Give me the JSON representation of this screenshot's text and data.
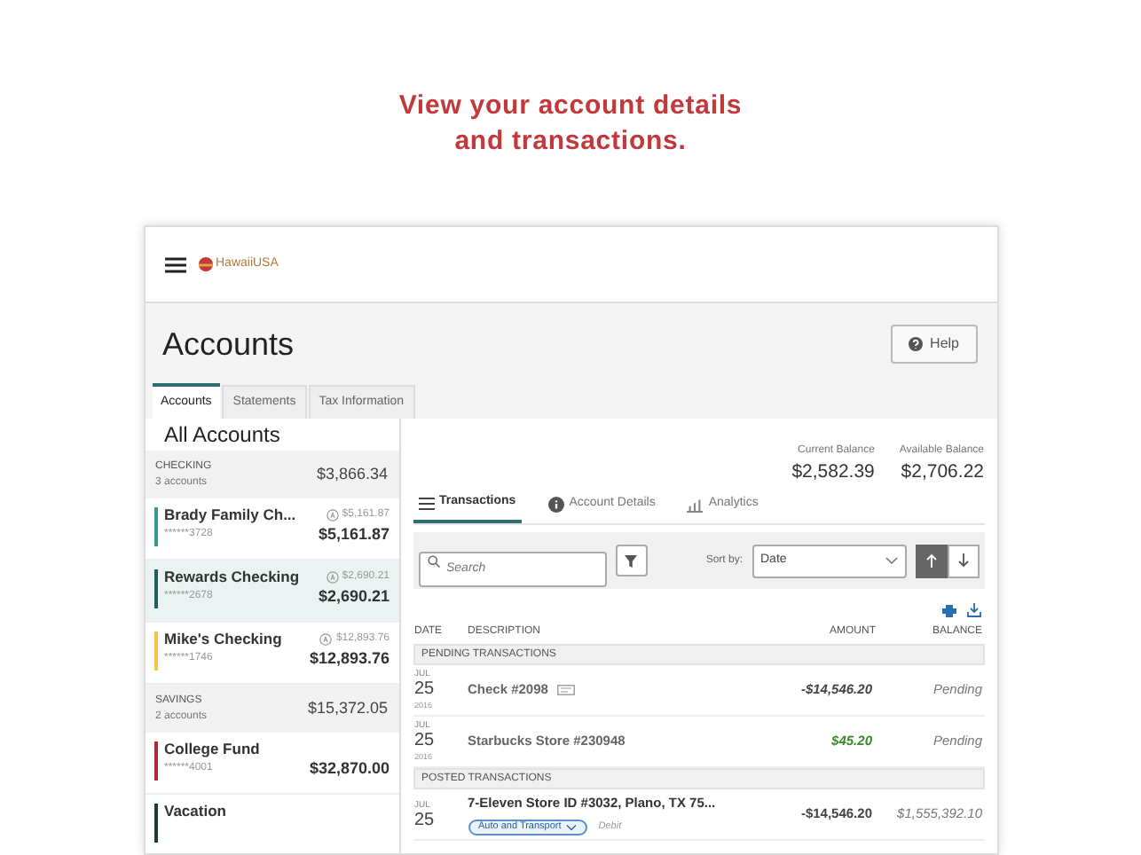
{
  "headline": [
    "View your account details",
    "and transactions."
  ],
  "header": {
    "logo_text": "HawaiiUSA"
  },
  "page": {
    "title": "Accounts",
    "help_button": "Help"
  },
  "tabs": [
    {
      "label": "Accounts",
      "selected": true
    },
    {
      "label": "Statements",
      "selected": false
    },
    {
      "label": "Tax Information",
      "selected": false
    }
  ],
  "sidebar": {
    "title": "All Accounts",
    "groups": [
      {
        "name": "CHECKING",
        "count": "3 accounts",
        "total": "$3,866.34",
        "accounts": [
          {
            "name": "Brady Family Ch...",
            "number": "******3728",
            "available": "$5,161.87",
            "balance": "$5,161.87",
            "color": "#3a9b8c",
            "selected": false
          },
          {
            "name": "Rewards Checking",
            "number": "******2678",
            "available": "$2,690.21",
            "balance": "$2,690.21",
            "color": "#1f5f5b",
            "selected": true
          },
          {
            "name": "Mike's Checking",
            "number": "******1746",
            "available": "$12,893.76",
            "balance": "$12,893.76",
            "color": "#f2c14e",
            "selected": false
          }
        ]
      },
      {
        "name": "SAVINGS",
        "count": "2 accounts",
        "total": "$15,372.05",
        "accounts": [
          {
            "name": "College Fund",
            "number": "******4001",
            "balance": "$32,870.00",
            "color": "#b22a37",
            "selected": false
          },
          {
            "name": "Vacation",
            "color": "#1b3b3b",
            "selected": false
          }
        ]
      }
    ]
  },
  "balances": [
    {
      "label": "Current Balance",
      "value": "$2,582.39"
    },
    {
      "label": "Available Balance",
      "value": "$2,706.22"
    }
  ],
  "detail_tabs": [
    {
      "label": "Transactions",
      "selected": true
    },
    {
      "label": "Account Details",
      "selected": false
    },
    {
      "label": "Analytics",
      "selected": false
    }
  ],
  "toolbar": {
    "search_placeholder": "Search",
    "sort_label": "Sort by:",
    "sort_value": "Date",
    "sort_ascending": true
  },
  "table": {
    "columns": [
      "DATE",
      "DESCRIPTION",
      "AMOUNT",
      "BALANCE"
    ],
    "sections": [
      {
        "title": "PENDING TRANSACTIONS",
        "rows": [
          {
            "month": "JUL",
            "day": "25",
            "year": "2016",
            "description": "Check #2098",
            "has_check_image": true,
            "amount": "-$14,546.20",
            "credit": false,
            "balance": "Pending"
          },
          {
            "month": "JUL",
            "day": "25",
            "year": "2016",
            "description": "Starbucks Store #230948",
            "has_check_image": false,
            "amount": "$45.20",
            "credit": true,
            "balance": "Pending"
          }
        ]
      },
      {
        "title": "POSTED TRANSACTIONS",
        "rows": [
          {
            "month": "JUL",
            "day": "25",
            "description": "7-Eleven Store ID #3032, Plano, TX 75...",
            "has_check_image": false,
            "category": "Auto and Transport",
            "type": "Debit",
            "amount": "-$14,546.20",
            "credit": false,
            "balance": "$1,555,392.10"
          }
        ]
      }
    ]
  }
}
